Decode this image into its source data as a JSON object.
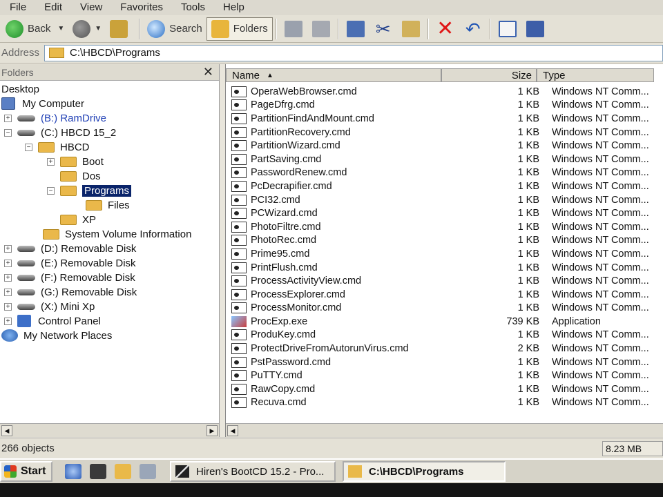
{
  "menu": [
    "File",
    "Edit",
    "View",
    "Favorites",
    "Tools",
    "Help"
  ],
  "toolbar": {
    "back": "Back",
    "search": "Search",
    "folders": "Folders"
  },
  "address": {
    "label": "Address",
    "path": "C:\\HBCD\\Programs"
  },
  "folders_pane": {
    "title": "Folders",
    "close": "✕",
    "tree": [
      {
        "label": "Desktop"
      },
      {
        "label": "My Computer"
      },
      {
        "label": "(B:) RamDrive"
      },
      {
        "label": "(C:) HBCD 15_2"
      },
      {
        "label": "HBCD"
      },
      {
        "label": "Boot"
      },
      {
        "label": "Dos"
      },
      {
        "label": "Programs"
      },
      {
        "label": "Files"
      },
      {
        "label": "XP"
      },
      {
        "label": "System Volume Information"
      },
      {
        "label": "(D:) Removable Disk"
      },
      {
        "label": "(E:) Removable Disk"
      },
      {
        "label": "(F:) Removable Disk"
      },
      {
        "label": "(G:) Removable Disk"
      },
      {
        "label": "(X:) Mini Xp"
      },
      {
        "label": "Control Panel"
      },
      {
        "label": "My Network Places"
      }
    ]
  },
  "columns": {
    "name": "Name",
    "size": "Size",
    "type": "Type"
  },
  "files": [
    {
      "name": "OperaWebBrowser.cmd",
      "size": "1 KB",
      "type": "Windows NT Comm..."
    },
    {
      "name": "PageDfrg.cmd",
      "size": "1 KB",
      "type": "Windows NT Comm..."
    },
    {
      "name": "PartitionFindAndMount.cmd",
      "size": "1 KB",
      "type": "Windows NT Comm..."
    },
    {
      "name": "PartitionRecovery.cmd",
      "size": "1 KB",
      "type": "Windows NT Comm..."
    },
    {
      "name": "PartitionWizard.cmd",
      "size": "1 KB",
      "type": "Windows NT Comm..."
    },
    {
      "name": "PartSaving.cmd",
      "size": "1 KB",
      "type": "Windows NT Comm..."
    },
    {
      "name": "PasswordRenew.cmd",
      "size": "1 KB",
      "type": "Windows NT Comm..."
    },
    {
      "name": "PcDecrapifier.cmd",
      "size": "1 KB",
      "type": "Windows NT Comm..."
    },
    {
      "name": "PCI32.cmd",
      "size": "1 KB",
      "type": "Windows NT Comm..."
    },
    {
      "name": "PCWizard.cmd",
      "size": "1 KB",
      "type": "Windows NT Comm..."
    },
    {
      "name": "PhotoFiltre.cmd",
      "size": "1 KB",
      "type": "Windows NT Comm..."
    },
    {
      "name": "PhotoRec.cmd",
      "size": "1 KB",
      "type": "Windows NT Comm..."
    },
    {
      "name": "Prime95.cmd",
      "size": "1 KB",
      "type": "Windows NT Comm..."
    },
    {
      "name": "PrintFlush.cmd",
      "size": "1 KB",
      "type": "Windows NT Comm..."
    },
    {
      "name": "ProcessActivityView.cmd",
      "size": "1 KB",
      "type": "Windows NT Comm..."
    },
    {
      "name": "ProcessExplorer.cmd",
      "size": "1 KB",
      "type": "Windows NT Comm..."
    },
    {
      "name": "ProcessMonitor.cmd",
      "size": "1 KB",
      "type": "Windows NT Comm..."
    },
    {
      "name": "ProcExp.exe",
      "size": "739 KB",
      "type": "Application"
    },
    {
      "name": "ProduKey.cmd",
      "size": "1 KB",
      "type": "Windows NT Comm..."
    },
    {
      "name": "ProtectDriveFromAutorunVirus.cmd",
      "size": "2 KB",
      "type": "Windows NT Comm..."
    },
    {
      "name": "PstPassword.cmd",
      "size": "1 KB",
      "type": "Windows NT Comm..."
    },
    {
      "name": "PuTTY.cmd",
      "size": "1 KB",
      "type": "Windows NT Comm..."
    },
    {
      "name": "RawCopy.cmd",
      "size": "1 KB",
      "type": "Windows NT Comm..."
    },
    {
      "name": "Recuva.cmd",
      "size": "1 KB",
      "type": "Windows NT Comm..."
    }
  ],
  "status": {
    "objects": "266 objects",
    "size": "8.23 MB"
  },
  "taskbar": {
    "start": "Start",
    "task1": "Hiren's BootCD 15.2 - Pro...",
    "task2": "C:\\HBCD\\Programs"
  }
}
